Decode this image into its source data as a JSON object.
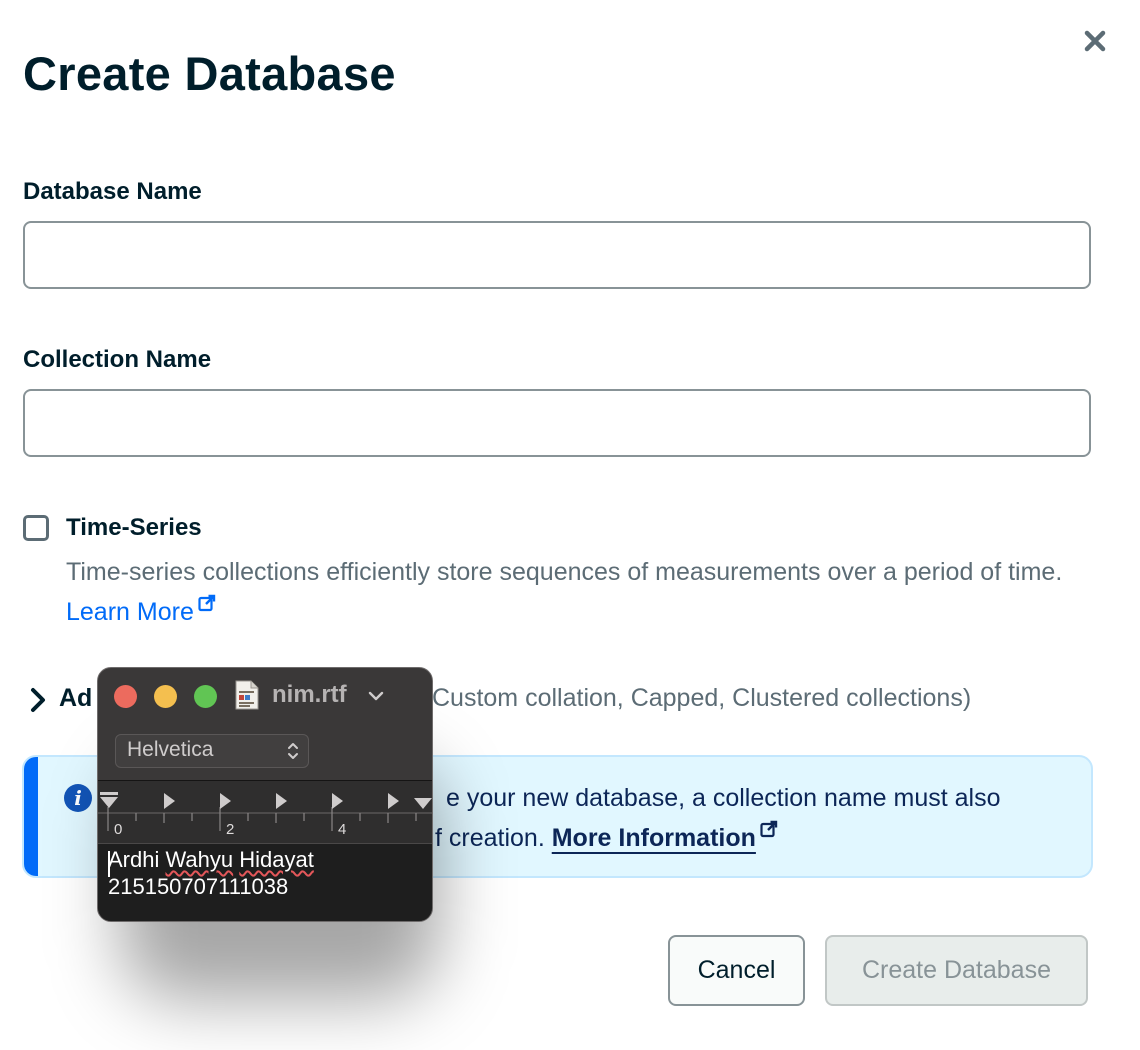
{
  "dialog": {
    "title": "Create Database",
    "close_icon": "close-icon"
  },
  "fields": {
    "database_name_label": "Database Name",
    "database_name_value": "",
    "collection_name_label": "Collection Name",
    "collection_name_value": ""
  },
  "time_series": {
    "checked": false,
    "label": "Time-Series",
    "description": "Time-series collections efficiently store sequences of measurements over a period of time.",
    "learn_more": "Learn More"
  },
  "advanced": {
    "title_visible": "Ad",
    "subtitle_visible": "Custom collation, Capped, Clustered collections)"
  },
  "banner": {
    "icon": "info-icon",
    "line1_visible": "e your new database, a collection name must also",
    "line2_visible": "f creation.",
    "link": "More Information"
  },
  "buttons": {
    "cancel": "Cancel",
    "create": "Create Database"
  },
  "textedit": {
    "filename": "nim.rtf",
    "font": "Helvetica",
    "ruler_labels": [
      "0",
      "2",
      "4"
    ],
    "line1_name_first": "Ardhi",
    "line1_name_middle": "Wahyu",
    "line1_name_last": "Hidayat",
    "line2": "215150707111038"
  },
  "colors": {
    "primary_text": "#001e2b",
    "link_blue": "#016bf8",
    "info_bg": "#e1f7ff",
    "info_accent": "#016bf8",
    "disabled_text": "#889397"
  }
}
